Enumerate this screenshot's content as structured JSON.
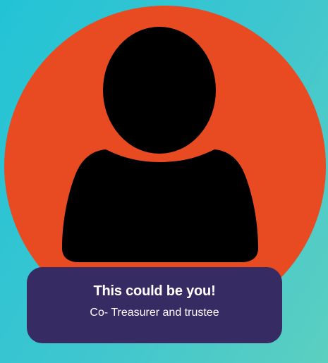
{
  "profile": {
    "avatar_icon": "person-silhouette-icon",
    "title": "This could be you!",
    "role": "Co- Treasurer and trustee"
  },
  "colors": {
    "background_start": "#22c3d6",
    "background_end": "#5ccfc0",
    "circle": "#e84a21",
    "silhouette": "#000000",
    "caption_background": "#362b63",
    "caption_text": "#ffffff"
  }
}
